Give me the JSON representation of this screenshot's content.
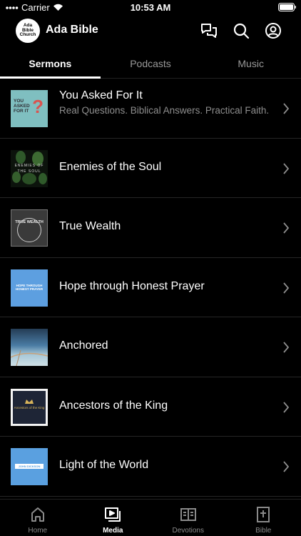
{
  "status_bar": {
    "carrier": "Carrier",
    "time": "10:53 AM"
  },
  "header": {
    "logo_lines": [
      "Ada",
      "Bible",
      "Church"
    ],
    "title": "Ada Bible"
  },
  "tabs": [
    {
      "label": "Sermons",
      "active": true
    },
    {
      "label": "Podcasts",
      "active": false
    },
    {
      "label": "Music",
      "active": false
    }
  ],
  "sermons": [
    {
      "title": "You Asked For It",
      "subtitle": "Real Questions. Biblical Answers. Practical Faith.",
      "thumb_text": "YOU ASKED FOR IT"
    },
    {
      "title": "Enemies of the Soul",
      "thumb_text": "ENEMIES OF THE SOUL"
    },
    {
      "title": "True Wealth",
      "thumb_text": "TRUE WEALTH"
    },
    {
      "title": "Hope through Honest Prayer",
      "thumb_text": "HOPE THROUGH HONEST PRAYER"
    },
    {
      "title": "Anchored"
    },
    {
      "title": "Ancestors of the King",
      "thumb_text": "Ancestors of the King"
    },
    {
      "title": "Light of the World",
      "thumb_text": "JOHN DICKSON"
    }
  ],
  "bottom_nav": [
    {
      "label": "Home",
      "icon": "home-icon",
      "active": false
    },
    {
      "label": "Media",
      "icon": "media-icon",
      "active": true
    },
    {
      "label": "Devotions",
      "icon": "devotions-icon",
      "active": false
    },
    {
      "label": "Bible",
      "icon": "bible-icon",
      "active": false
    }
  ],
  "colors": {
    "background": "#000000",
    "text": "#ffffff",
    "subtitle": "#8e8e8e",
    "inactive": "#8a8a8a"
  }
}
